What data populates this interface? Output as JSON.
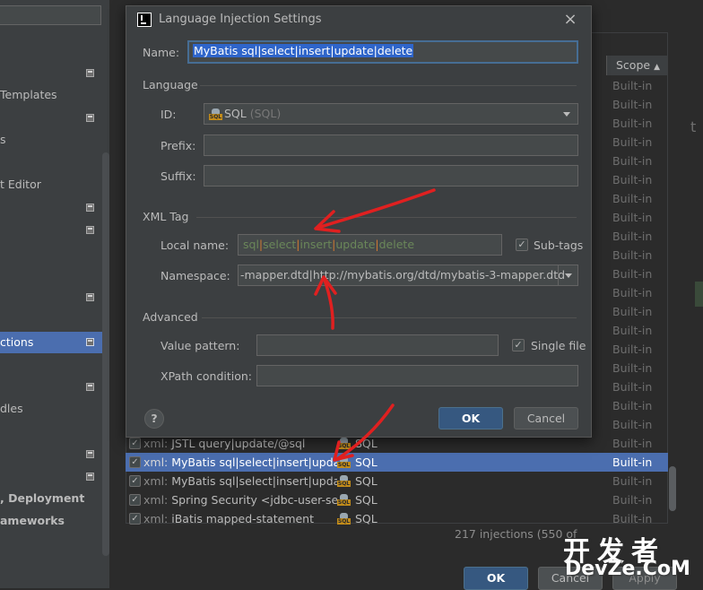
{
  "sidebar": {
    "items": [
      {
        "label": "Templates",
        "bold": false,
        "selected": false
      },
      {
        "label": "s",
        "bold": false,
        "selected": false
      },
      {
        "label": "t Editor",
        "bold": false,
        "selected": false
      },
      {
        "label": "ctions",
        "bold": false,
        "selected": false
      },
      {
        "label": "dles",
        "bold": false,
        "selected": false
      },
      {
        "label": ", Deployment",
        "bold": true,
        "selected": false
      },
      {
        "label": "ameworks",
        "bold": true,
        "selected": false
      }
    ]
  },
  "background": {
    "scope_header": "Scope",
    "scope_value": "Built-in",
    "rows": [
      {
        "kind": "xml:",
        "text": " JSTL query|update/@sql",
        "lang": "SQL",
        "scope": "Built-in",
        "selected": false
      },
      {
        "kind": "xml:",
        "text": " MyBatis sql|select|insert|update|d",
        "lang": "SQL",
        "scope": "Built-in",
        "selected": true
      },
      {
        "kind": "xml:",
        "text": " MyBatis sql|select|insert|update|d",
        "lang": "SQL",
        "scope": "Built-in",
        "selected": false
      },
      {
        "kind": "xml:",
        "text": " Spring Security <jdbc-user-servic",
        "lang": "SQL",
        "scope": "Built-in",
        "selected": false
      },
      {
        "kind": "xml:",
        "text": " iBatis mapped-statement",
        "lang": "SQL",
        "scope": "Built-in",
        "selected": false
      }
    ],
    "injections_count": "217 injections (550 of",
    "ok_label": "OK",
    "cancel_label": "Cancel",
    "apply_label": "Apply"
  },
  "dialog": {
    "title": "Language Injection Settings",
    "close_glyph": "×",
    "name_label": "Name:",
    "name_value": "MyBatis sql|select|insert|update|delete",
    "language_section": "Language",
    "id_label": "ID:",
    "id_value": "SQL",
    "id_hint": " (SQL)",
    "prefix_label": "Prefix:",
    "prefix_value": "",
    "suffix_label": "Suffix:",
    "suffix_value": "",
    "xml_tag_section": "XML Tag",
    "local_name_label": "Local name:",
    "local_name_parts": [
      "sql",
      "|",
      "select",
      "|",
      "insert",
      "|",
      "update",
      "|",
      "delete"
    ],
    "subtags_label": "Sub-tags",
    "subtags_checked": true,
    "namespace_label": "Namespace:",
    "namespace_value": "-mapper.dtd|http://mybatis.org/dtd/mybatis-3-mapper.dtd",
    "advanced_section": "Advanced",
    "value_pattern_label": "Value pattern:",
    "value_pattern_value": "",
    "single_file_label": "Single file",
    "single_file_checked": true,
    "xpath_label": "XPath condition:",
    "xpath_value": "",
    "help_glyph": "?",
    "ok_label": "OK",
    "cancel_label": "Cancel"
  },
  "icons": {
    "sql_icon_label": "SQL",
    "checkmark": "✓"
  },
  "watermark": {
    "cn": "开发者",
    "en": "DevZe.CoM"
  },
  "colors": {
    "accent": "#4b6eaf",
    "annotation": "#e02020",
    "ok_button": "#365880",
    "local_name_word": "#6a8759",
    "local_name_pipe": "#cc7832"
  }
}
